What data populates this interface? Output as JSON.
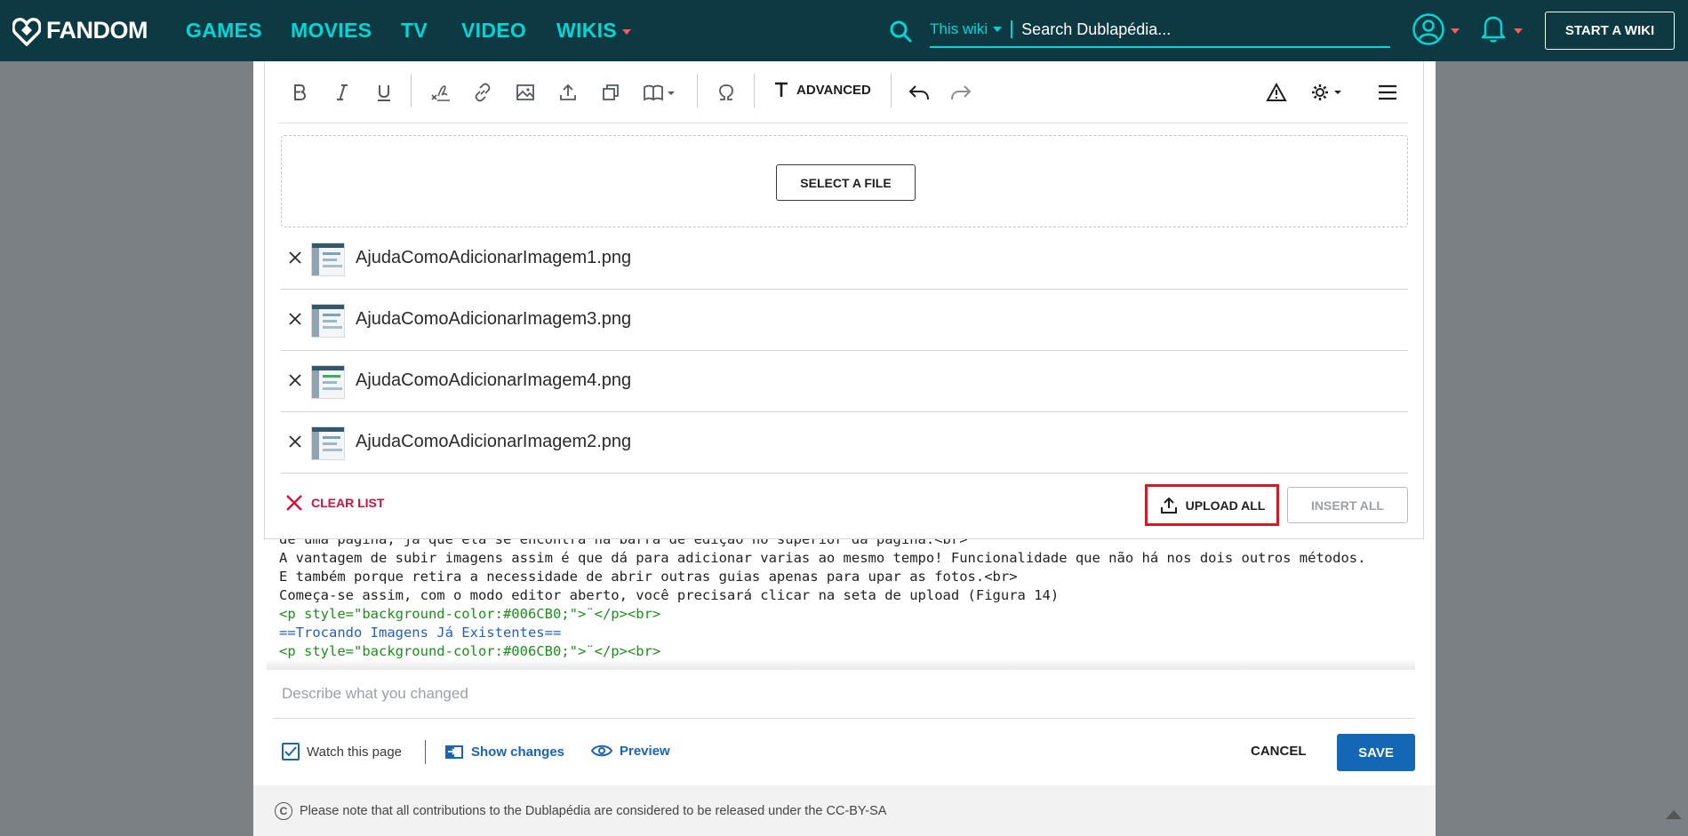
{
  "topnav": {
    "brand": "FANDOM",
    "items": [
      {
        "label": "GAMES"
      },
      {
        "label": "MOVIES"
      },
      {
        "label": "TV"
      },
      {
        "label": "VIDEO"
      },
      {
        "label": "WIKIS"
      }
    ],
    "search_scope": "This wiki",
    "search_placeholder": "Search Dublapédia...",
    "start_wiki": "START A WIKI",
    "colors": {
      "bar": "#0d3a42",
      "accent": "#00d6d6",
      "caret": "#fa5c5c"
    }
  },
  "toolbar": {
    "advanced_label": "ADVANCED"
  },
  "upload": {
    "select_file": "SELECT A FILE",
    "files": [
      {
        "name": "AjudaComoAdicionarImagem1.png"
      },
      {
        "name": "AjudaComoAdicionarImagem3.png"
      },
      {
        "name": "AjudaComoAdicionarImagem4.png"
      },
      {
        "name": "AjudaComoAdicionarImagem2.png"
      }
    ],
    "clear_list": "CLEAR LIST",
    "upload_all": "UPLOAD ALL",
    "insert_all": "INSERT ALL"
  },
  "editor": {
    "lines": [
      "de uma pagina, já que ela se encontra na barra de edição no superior da página.<br>",
      "A vantagem de subir imagens assim é que dá para adicionar varias ao mesmo tempo! Funcionalidade que não há nos dois outros métodos.",
      "E também porque retira a necessidade de abrir outras guias apenas para upar as fotos.<br>",
      "Começa-se assim, com o modo editor aberto, você precisará clicar na seta de upload (Figura 14)",
      "<p style=\"background-color:#006CB0;\">¨</p><br>",
      "==Trocando Imagens Já Existentes==",
      "",
      "<p style=\"background-color:#006CB0;\">¨</p><br>"
    ]
  },
  "footer": {
    "summary_placeholder": "Describe what you changed",
    "watch_label": "Watch this page",
    "watch_checked": true,
    "show_changes": "Show changes",
    "preview": "Preview",
    "cancel": "CANCEL",
    "save": "SAVE",
    "license": "Please note that all contributions to the Dublapédia are considered to be released under the CC-BY-SA"
  }
}
